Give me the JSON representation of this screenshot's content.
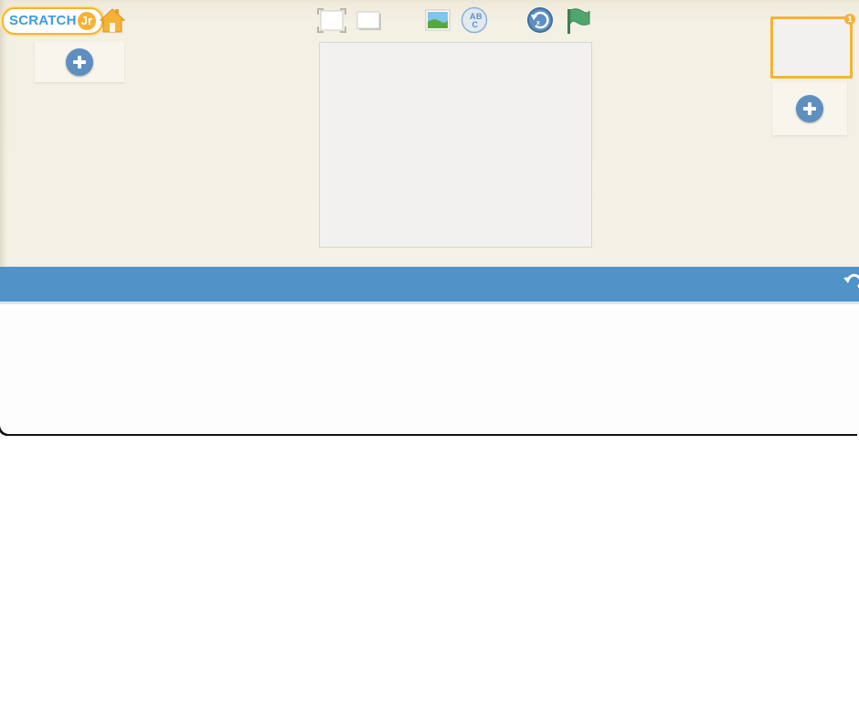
{
  "app": {
    "logo_text": "SCRATCH",
    "logo_suffix": "Jr"
  },
  "sprites": {
    "add_label": "+"
  },
  "pages": {
    "current_page_number": "1"
  },
  "icons": {
    "home": "home-icon",
    "fullscreen": "fullscreen-icon",
    "grid": "grid-toggle-icon",
    "background": "background-image-icon",
    "text": "text-abc-icon",
    "reset": "reset-characters-icon",
    "green_flag": "green-flag-icon",
    "undo": "undo-icon",
    "add": "plus-icon"
  },
  "colors": {
    "accent_orange": "#f5b335",
    "palette_blue": "#4f93c9",
    "add_blue": "#5f8fc0",
    "flag_green": "#4fa56a",
    "editor_beige": "#f4f1e6"
  }
}
